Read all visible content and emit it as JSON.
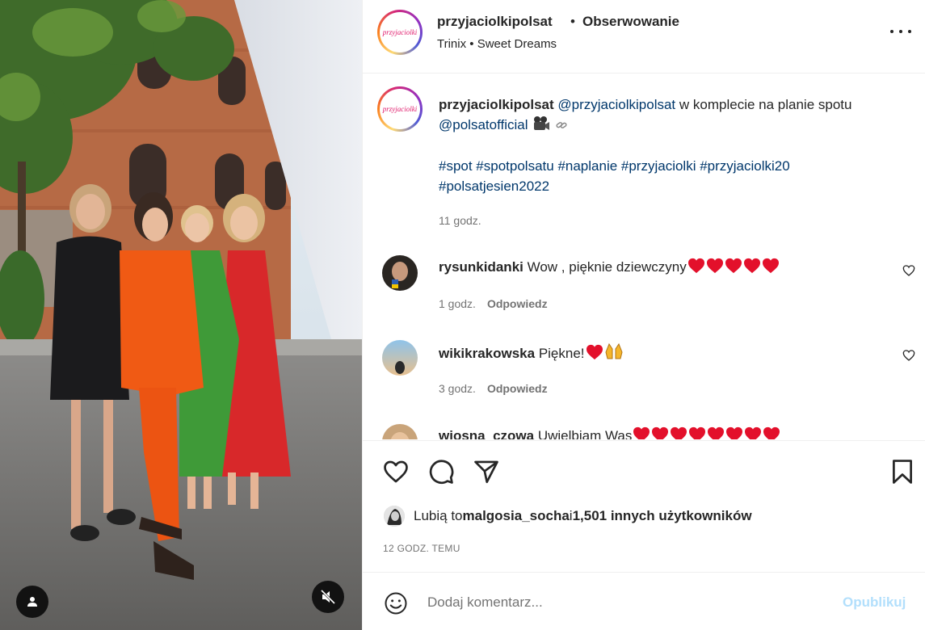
{
  "post": {
    "username": "przyjaciolkipolsat",
    "separator": "•",
    "follow_status": "Obserwowanie",
    "audio": "Trinix • Sweet Dreams",
    "avatar_logo_text": "przyjaciolki"
  },
  "caption": {
    "username": "przyjaciolkipolsat",
    "mention1": "@przyjaciolkipolsat",
    "text1": " w komplecie na planie spotu ",
    "mention2": "@polsatofficial",
    "hashtags": "#spot #spotpolsatu #naplanie #przyjaciolki #przyjaciolki20 #polsatjesien2022",
    "time": "11 godz."
  },
  "comments": [
    {
      "username": "rysunkidanki",
      "text": "Wow , pięknie dziewczyny",
      "time": "1 godz.",
      "reply": "Odpowiedz",
      "emoji": [
        "red-heart",
        "red-heart",
        "red-heart",
        "red-heart",
        "red-heart"
      ]
    },
    {
      "username": "wikikrakowska",
      "text": "Piękne!",
      "time": "3 godz.",
      "reply": "Odpowiedz",
      "emoji": [
        "red-heart",
        "raising-hands"
      ]
    },
    {
      "username": "wiosna_czowa",
      "text": "Uwielbiam Was",
      "time": "",
      "reply": "",
      "emoji": [
        "red-heart",
        "red-heart",
        "red-heart",
        "red-heart",
        "red-heart",
        "red-heart",
        "red-heart",
        "red-heart"
      ]
    }
  ],
  "likes": {
    "prefix": "Lubią to ",
    "user": "malgosia_socha",
    "middle": " i ",
    "count": "1,501 innych użytkowników"
  },
  "posted_ago": "12 GODZ. TEMU",
  "add_comment": {
    "placeholder": "Dodaj komentarz...",
    "post_label": "Opublikuj"
  },
  "colors": {
    "link": "#00376b",
    "muted": "#737373",
    "post_disabled": "#b2dffc",
    "heart": "#e3102b"
  }
}
